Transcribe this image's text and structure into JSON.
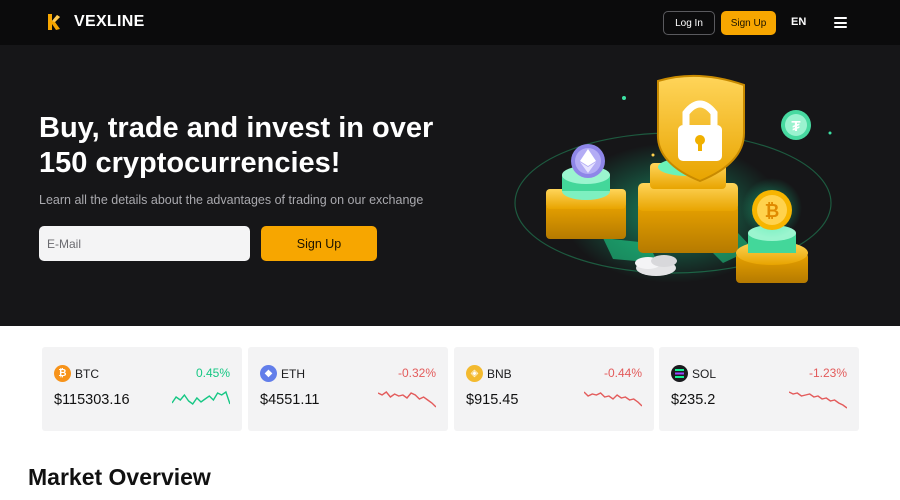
{
  "header": {
    "brand": "VEXLINE",
    "login_label": "Log In",
    "signup_label": "Sign Up",
    "language": "EN"
  },
  "hero": {
    "title": "Buy, trade and invest in over 150 cryptocurrencies!",
    "subtitle": "Learn all the details about the advantages of trading on our exchange",
    "email_placeholder": "E-Mail",
    "signup_label": "Sign Up"
  },
  "tickers": [
    {
      "symbol": "BTC",
      "change": "0.45%",
      "price": "$115303.16",
      "direction": "up",
      "icon": "bitcoin-icon",
      "icon_color": "#f7931a",
      "spark": [
        14,
        8,
        11,
        6,
        12,
        15,
        9,
        13,
        10,
        7,
        11,
        4,
        6,
        3,
        15
      ]
    },
    {
      "symbol": "ETH",
      "change": "-0.32%",
      "price": "$4551.11",
      "direction": "down",
      "icon": "ethereum-icon",
      "icon_color": "#627eea",
      "spark": [
        4,
        6,
        3,
        8,
        5,
        7,
        6,
        9,
        4,
        6,
        10,
        8,
        11,
        14,
        18
      ]
    },
    {
      "symbol": "BNB",
      "change": "-0.44%",
      "price": "$915.45",
      "direction": "down",
      "icon": "bnb-icon",
      "icon_color": "#f3ba2f",
      "spark": [
        3,
        7,
        5,
        6,
        4,
        8,
        7,
        10,
        6,
        9,
        8,
        11,
        10,
        13,
        17
      ]
    },
    {
      "symbol": "SOL",
      "change": "-1.23%",
      "price": "$235.2",
      "direction": "down",
      "icon": "solana-icon",
      "icon_color": "#1b1b1f",
      "spark": [
        3,
        5,
        4,
        7,
        6,
        5,
        8,
        7,
        10,
        9,
        12,
        11,
        14,
        16,
        19
      ]
    }
  ],
  "colors": {
    "accent": "#f7a600",
    "up": "#16c784",
    "down": "#e35b5b",
    "hero_bg": "#161618"
  },
  "market": {
    "title": "Market Overview"
  }
}
